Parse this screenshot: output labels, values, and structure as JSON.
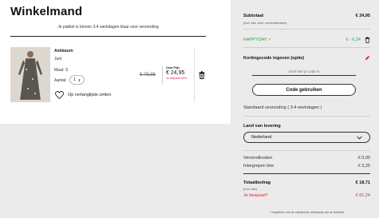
{
  "page": {
    "title": "Winkelmand",
    "delivery_note": "Je pakket is binnen 3-4 werkdagen klaar voor verzending"
  },
  "item": {
    "brand": "Ashbourn",
    "type": "Jurk",
    "size_label": "Maat: S",
    "qty_label": "Aantal:",
    "qty_value": "1",
    "wishlist_label": "Op verlanglijste zetten",
    "old_price": "€ 79,95",
    "price_label": "Onze Prijs",
    "price": "€ 24,95",
    "saved": "Je bespaart 69%"
  },
  "summary": {
    "subtotal_label": "Subtotaal",
    "subtotal_value": "€ 24,95",
    "subtotal_note": "(incl. btw, excl. verzendkosten)",
    "coupon_code": "HAPPYDAY ✓",
    "coupon_discount": "€ - 6,24",
    "discount_heading": "Kortingscode ingeven (optie)",
    "coupon_placeholder": "Geef hier je code in",
    "apply_label": "Code gebruiken",
    "shipping_method": "Standaard verzending ( 3-4 werkdagen )",
    "country_heading": "Land van levering",
    "country_value": "Nederland",
    "shipping_label": "Verzendkosten",
    "shipping_value": "€ 0,00",
    "vat_label": "Inbegrepen btw",
    "vat_value": "€ 3,25",
    "total_label": "Totaalbedrag",
    "total_value": "€ 18,71",
    "total_note": "(incl. btw)",
    "saved_label": "Je bespaart*",
    "saved_value": "€ 61,24",
    "footnote": "* vergeleken met de vrijblijvende adviesprijs van de fabrikant"
  },
  "colors": {
    "green": "#2da44e",
    "red": "#d7263d",
    "background": "#ebebeb"
  },
  "icons": [
    "heart-icon",
    "trash-icon",
    "pencil-icon",
    "chevron-down-icon",
    "check-icon"
  ]
}
